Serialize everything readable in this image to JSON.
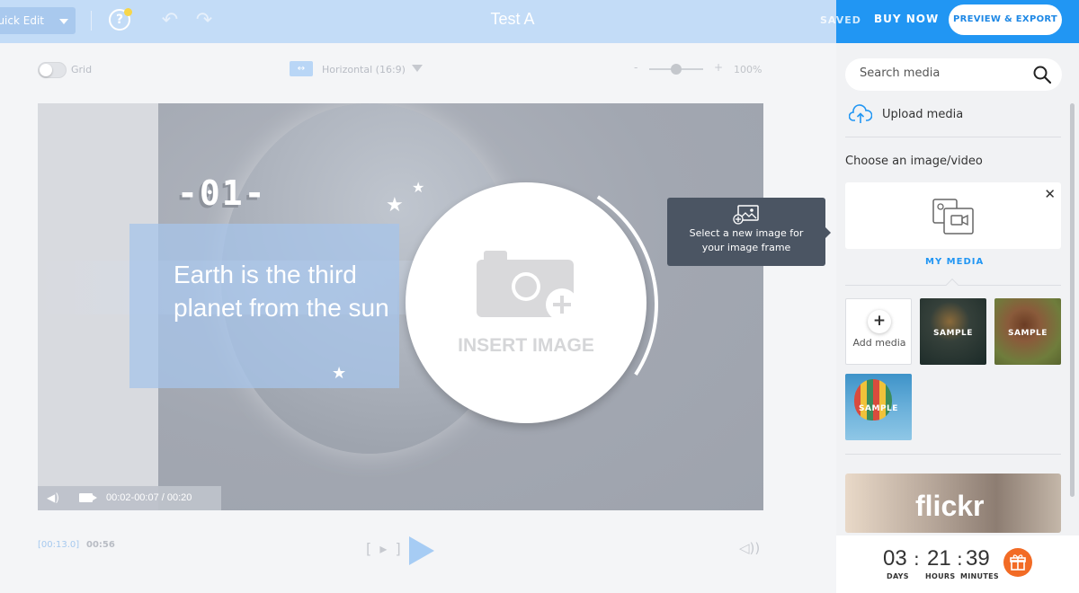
{
  "header": {
    "mode_label": "Quick Edit",
    "doc_title": "Test A",
    "saved_label": "SAVED",
    "buy_now_label": "BUY NOW",
    "preview_export_label": "PREVIEW & EXPORT",
    "help_icon": "help-icon",
    "undo_icon": "undo-icon",
    "redo_icon": "redo-icon",
    "colors": {
      "topbar": "#c3dcf7",
      "accent": "#2196f3"
    }
  },
  "toolbar": {
    "grid_label": "Grid",
    "grid_enabled": false,
    "orientation_label": "Horizontal (16:9)",
    "zoom_minus": "-",
    "zoom_plus": "+",
    "zoom_value": "100%"
  },
  "canvas": {
    "number_label": "-01-",
    "headline": "Earth is the third planet from the sun",
    "insert_image_label": "INSERT IMAGE",
    "video_time": "00:02-00:07 / 00:20"
  },
  "tooltip": {
    "text": "Select a new image for your image frame",
    "icon": "image-frame-icon"
  },
  "playback": {
    "timecode": "[00:13.0]",
    "duration": "00:56",
    "frame_step": "[ ▸ ]"
  },
  "sidebar": {
    "search_placeholder": "Search media",
    "upload_label": "Upload media",
    "choose_label": "Choose an image/video",
    "my_media_tab": "MY MEDIA",
    "add_media_label": "Add media",
    "add_plus": "+",
    "close_symbol": "✕",
    "thumbnails": [
      {
        "label": "SAMPLE"
      },
      {
        "label": "SAMPLE"
      },
      {
        "label": "SAMPLE"
      }
    ],
    "flickr_label": "flickr"
  },
  "countdown": {
    "days": "03",
    "hours": "21",
    "minutes": "39",
    "days_label": "DAYS",
    "hours_label": "HOURS",
    "minutes_label": "MINUTES",
    "separator": ":"
  }
}
